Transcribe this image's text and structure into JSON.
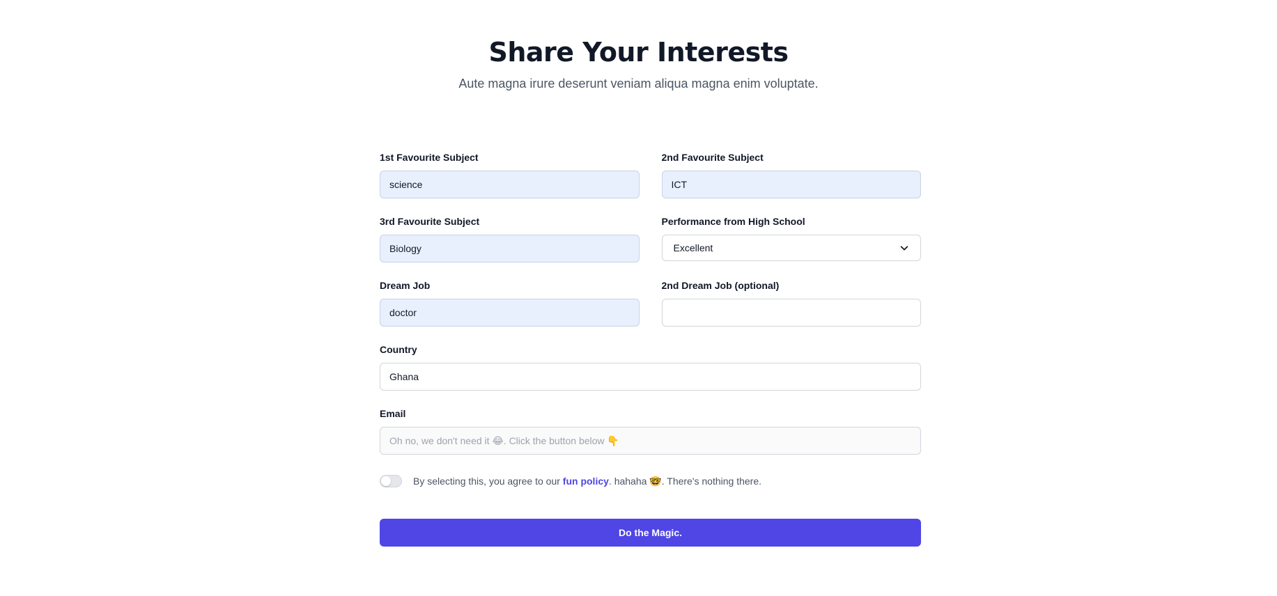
{
  "header": {
    "title": "Share Your Interests",
    "subtitle": "Aute magna irure deserunt veniam aliqua magna enim voluptate."
  },
  "fields": {
    "subject1": {
      "label": "1st Favourite Subject",
      "value": "science"
    },
    "subject2": {
      "label": "2nd Favourite Subject",
      "value": "ICT"
    },
    "subject3": {
      "label": "3rd Favourite Subject",
      "value": "Biology"
    },
    "performance": {
      "label": "Performance from High School",
      "value": "Excellent"
    },
    "dream_job": {
      "label": "Dream Job",
      "value": "doctor"
    },
    "dream_job2": {
      "label": "2nd Dream Job (optional)",
      "value": ""
    },
    "country": {
      "label": "Country",
      "value": "Ghana"
    },
    "email": {
      "label": "Email",
      "placeholder": "Oh no, we don't need it 😂. Click the button below 👇"
    }
  },
  "agreement": {
    "text_before": "By selecting this, you agree to our ",
    "link": "fun policy",
    "text_after": ". hahaha 🤓. There's nothing there.",
    "checked": false
  },
  "submit": {
    "label": "Do the Magic."
  },
  "colors": {
    "accent": "#4f46e5",
    "autofill_bg": "#e8f0fe",
    "title": "#111827",
    "subtitle": "#4b5563"
  },
  "icons": {
    "select_chevron": "chevron-down-icon"
  }
}
